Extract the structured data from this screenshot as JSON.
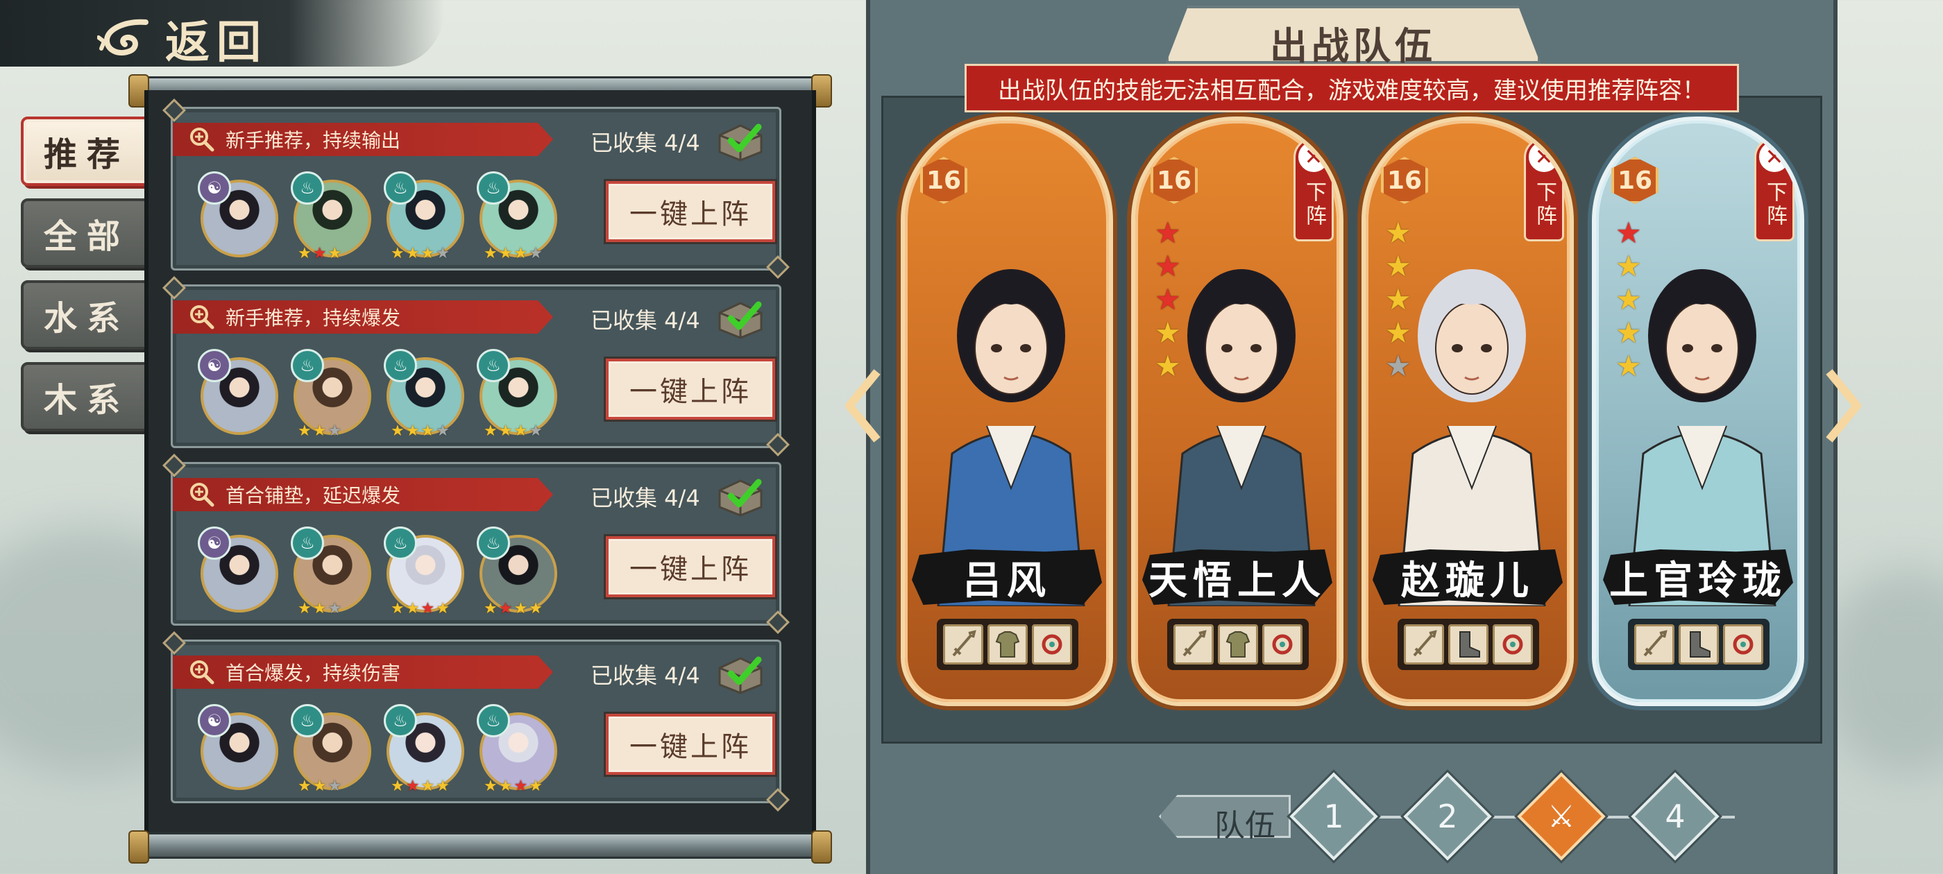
{
  "header": {
    "back_label": "返回"
  },
  "categories": [
    {
      "label": "推荐",
      "active": true
    },
    {
      "label": "全部",
      "active": false
    },
    {
      "label": "水系",
      "active": false
    },
    {
      "label": "木系",
      "active": false
    }
  ],
  "recommended_teams": [
    {
      "tag": "新手推荐，持续输出",
      "collected": "已收集 4/4",
      "deploy_label": "一键上阵",
      "members": [
        {
          "element": "yinyang",
          "portrait": "a1",
          "stars": []
        },
        {
          "element": "water",
          "portrait": "a2",
          "stars": [
            "gold",
            "red",
            "gold"
          ]
        },
        {
          "element": "water",
          "portrait": "a3",
          "stars": [
            "gold",
            "gold",
            "gold",
            "gray"
          ]
        },
        {
          "element": "water",
          "portrait": "a4",
          "stars": [
            "gold",
            "gold",
            "gold",
            "gray"
          ]
        }
      ]
    },
    {
      "tag": "新手推荐，持续爆发",
      "collected": "已收集 4/4",
      "deploy_label": "一键上阵",
      "members": [
        {
          "element": "yinyang",
          "portrait": "a1",
          "stars": []
        },
        {
          "element": "water",
          "portrait": "a5",
          "stars": [
            "gold",
            "gold",
            "gray"
          ]
        },
        {
          "element": "water",
          "portrait": "a3",
          "stars": [
            "gold",
            "gold",
            "gold",
            "gray"
          ]
        },
        {
          "element": "water",
          "portrait": "a4",
          "stars": [
            "gold",
            "gold",
            "gold",
            "gray"
          ]
        }
      ]
    },
    {
      "tag": "首合铺垫，延迟爆发",
      "collected": "已收集 4/4",
      "deploy_label": "一键上阵",
      "members": [
        {
          "element": "yinyang",
          "portrait": "a1",
          "stars": []
        },
        {
          "element": "water",
          "portrait": "a5",
          "stars": [
            "gold",
            "gold",
            "gray"
          ]
        },
        {
          "element": "water",
          "portrait": "a6",
          "stars": [
            "gold",
            "gold",
            "red",
            "gold"
          ]
        },
        {
          "element": "water",
          "portrait": "a7",
          "stars": [
            "gold",
            "red",
            "gold",
            "gold"
          ]
        }
      ]
    },
    {
      "tag": "首合爆发，持续伤害",
      "collected": "已收集 4/4",
      "deploy_label": "一键上阵",
      "members": [
        {
          "element": "yinyang",
          "portrait": "a1",
          "stars": []
        },
        {
          "element": "water",
          "portrait": "a5",
          "stars": [
            "gold",
            "gold",
            "gray"
          ]
        },
        {
          "element": "water",
          "portrait": "a8",
          "stars": [
            "gold",
            "red",
            "gold",
            "gold"
          ]
        },
        {
          "element": "water",
          "portrait": "a9",
          "stars": [
            "gold",
            "gold",
            "red",
            "gold"
          ]
        }
      ]
    }
  ],
  "battle_team": {
    "title": "出战队伍",
    "warning": "出战队伍的技能无法相互配合，游戏难度较高，建议使用推荐阵容！",
    "remove_label": "下阵",
    "characters": [
      {
        "name": "吕风",
        "level": "16",
        "stars": [],
        "removable": false,
        "theme": "orange",
        "equipment": [
          "sword-icon",
          "armor-icon",
          "accessory-icon"
        ]
      },
      {
        "name": "天悟上人",
        "level": "16",
        "stars": [
          "red",
          "red",
          "red",
          "gold",
          "gold"
        ],
        "removable": true,
        "theme": "orange",
        "equipment": [
          "sword-icon",
          "armor-icon",
          "accessory-icon"
        ]
      },
      {
        "name": "赵璇儿",
        "level": "16",
        "stars": [
          "gold",
          "gold",
          "gold",
          "gold",
          "gray"
        ],
        "removable": true,
        "theme": "orange",
        "equipment": [
          "sword-icon",
          "boots-icon",
          "accessory-icon"
        ]
      },
      {
        "name": "上官玲珑",
        "level": "16",
        "stars": [
          "red",
          "gold",
          "gold",
          "gold",
          "gold"
        ],
        "removable": true,
        "theme": "blue",
        "equipment": [
          "sword-icon",
          "boots-icon",
          "accessory-icon"
        ]
      }
    ]
  },
  "team_selector": {
    "label": "队伍",
    "slots": [
      {
        "label": "1",
        "active": false
      },
      {
        "label": "2",
        "active": false
      },
      {
        "label": "",
        "active": true
      },
      {
        "label": "4",
        "active": false
      }
    ]
  },
  "colors": {
    "accent_red": "#b3231d",
    "gold": "#f3c42d",
    "panel": "#5f7479"
  }
}
